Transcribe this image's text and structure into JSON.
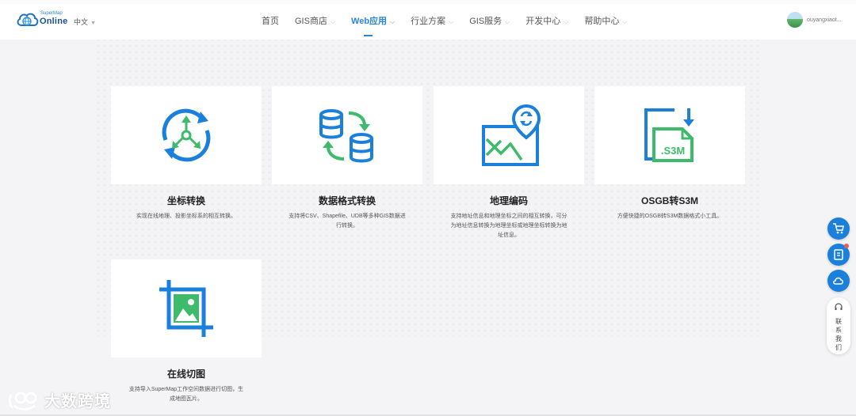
{
  "header": {
    "logo_small": "SuperMap",
    "logo_big": "Online",
    "language": "中文",
    "nav": [
      {
        "label": "首页",
        "has_menu": false,
        "active": false
      },
      {
        "label": "GIS商店",
        "has_menu": true,
        "active": false
      },
      {
        "label": "Web应用",
        "has_menu": true,
        "active": true
      },
      {
        "label": "行业方案",
        "has_menu": true,
        "active": false
      },
      {
        "label": "GIS服务",
        "has_menu": true,
        "active": false
      },
      {
        "label": "开发中心",
        "has_menu": true,
        "active": false
      },
      {
        "label": "帮助中心",
        "has_menu": true,
        "active": false
      }
    ],
    "username": "ouyangxiaot..."
  },
  "tools": [
    {
      "title": "坐标转换",
      "desc": "实现在线地理、投影坐标系的相互转换。",
      "icon": "coordinate-convert-icon"
    },
    {
      "title": "数据格式转换",
      "desc": "支持将CSV、Shapefile、UDB等多种GIS数据进行转换。",
      "icon": "data-format-convert-icon"
    },
    {
      "title": "地理编码",
      "desc": "支持地址信息和地理坐标之间的相互转换，可分为地址信息转换为地理坐标或地理坐标转换为地址信息。",
      "icon": "geocoding-icon"
    },
    {
      "title": "OSGB转S3M",
      "desc": "方便快捷的OSGB转S3M数据格式小工具。",
      "icon": "osgb-to-s3m-icon"
    },
    {
      "title": "在线切图",
      "desc": "支持导入SuperMap工作空间数据进行切图，生成地图瓦片。",
      "icon": "online-tile-cut-icon"
    }
  ],
  "s3m_label": ".S3M",
  "contact_label": "联系我们",
  "watermark": "大数跨境",
  "colors": {
    "accent": "#2b86d9",
    "icon_blue": "#1b7fdc",
    "icon_green": "#3dbb6b"
  }
}
